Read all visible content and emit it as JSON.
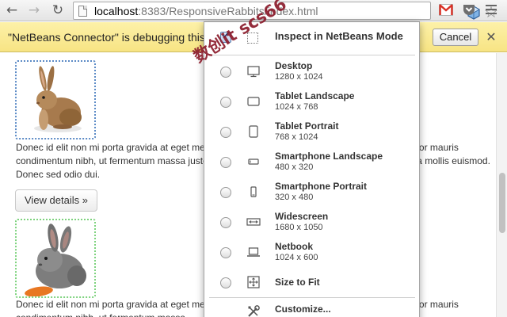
{
  "browser": {
    "back_glyph": "←",
    "forward_glyph": "→",
    "reload_glyph": "↻",
    "url_host": "localhost",
    "url_rest": ":8383/ResponsiveRabbits/index.html",
    "star_glyph": "☆"
  },
  "infobar": {
    "message": "\"NetBeans Connector\" is debugging this",
    "cancel_label": "Cancel",
    "close_glyph": "✕",
    "bg_color": "#f9e98f"
  },
  "page": {
    "paragraph_1": "Donec id elit non mi porta gravida at eget metus. Fusce dapibus, tellus ac cursus commodo, tortor mauris condimentum nibh, ut fermentum massa justo sit amet risus. Etiam porta sem malesuada magna mollis euismod. Donec sed odio dui.",
    "view_details_label": "View details »",
    "paragraph_2": "Donec id elit non mi porta gravida at eget metus. Fusce dapibus, tellus ac cursus commodo, tortor mauris condimentum nibh, ut fermentum massa"
  },
  "popup": {
    "inspect_label": "Inspect in NetBeans Mode",
    "inspect_checked": true,
    "options": [
      {
        "name": "Desktop",
        "dims": "1280 x 1024",
        "icon": "desktop-icon"
      },
      {
        "name": "Tablet Landscape",
        "dims": "1024 x 768",
        "icon": "tablet-landscape-icon"
      },
      {
        "name": "Tablet Portrait",
        "dims": "768 x 1024",
        "icon": "tablet-portrait-icon"
      },
      {
        "name": "Smartphone Landscape",
        "dims": "480 x 320",
        "icon": "smartphone-landscape-icon"
      },
      {
        "name": "Smartphone Portrait",
        "dims": "320 x 480",
        "icon": "smartphone-portrait-icon"
      },
      {
        "name": "Widescreen",
        "dims": "1680 x 1050",
        "icon": "widescreen-icon"
      },
      {
        "name": "Netbook",
        "dims": "1024 x 600",
        "icon": "netbook-icon"
      },
      {
        "name": "Size to Fit",
        "dims": "",
        "icon": "size-to-fit-icon"
      }
    ],
    "customize_label": "Customize..."
  },
  "watermark": "数创it scs66"
}
